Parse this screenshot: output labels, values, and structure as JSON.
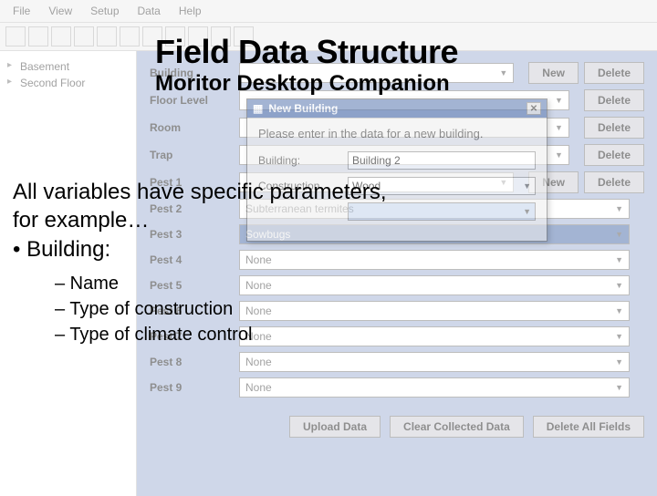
{
  "menubar": [
    "File",
    "View",
    "Setup",
    "Data",
    "Help"
  ],
  "tree": [
    "Basement",
    "Second Floor"
  ],
  "form": {
    "rows": [
      {
        "label": "Building",
        "value": "",
        "new": "New",
        "del": "Delete"
      },
      {
        "label": "Floor Level",
        "value": "",
        "new": "",
        "del": "Delete"
      },
      {
        "label": "Room",
        "value": "",
        "new": "",
        "del": "Delete"
      },
      {
        "label": "Trap",
        "value": "",
        "new": "",
        "del": "Delete"
      },
      {
        "label": "Pest 1",
        "value": "",
        "new": "New",
        "del": "Delete"
      },
      {
        "label": "Pest 2",
        "value": "Subterranean termites",
        "new": "",
        "del": ""
      },
      {
        "label": "Pest 3",
        "value": "Sowbugs",
        "new": "",
        "del": ""
      },
      {
        "label": "Pest 4",
        "value": "None",
        "new": "",
        "del": ""
      },
      {
        "label": "Pest 5",
        "value": "None",
        "new": "",
        "del": ""
      },
      {
        "label": "Pest 6",
        "value": "None",
        "new": "",
        "del": ""
      },
      {
        "label": "Pest 7",
        "value": "None",
        "new": "",
        "del": ""
      },
      {
        "label": "Pest 8",
        "value": "None",
        "new": "",
        "del": ""
      },
      {
        "label": "Pest 9",
        "value": "None",
        "new": "",
        "del": ""
      }
    ],
    "buttons": [
      "Upload Data",
      "Clear Collected Data",
      "Delete All Fields"
    ]
  },
  "dialog": {
    "title": "New Building",
    "close": "✕",
    "prompt": "Please enter in the data for a new building.",
    "fields": [
      {
        "label": "Building:",
        "value": "Building 2",
        "dropdown": false
      },
      {
        "label": "Construction",
        "value": "Wood",
        "dropdown": true
      },
      {
        "label": "",
        "value": "",
        "dropdown": true
      }
    ]
  },
  "overlay": {
    "title1": "Field Data Structure",
    "title2": "Moritor Desktop Companion",
    "body1a": "All variables have specific parameters,",
    "body1b": "for example…",
    "bullet": "• Building:",
    "sub1": "– Name",
    "sub2": "– Type of construction",
    "sub3": "– Type of climate control"
  }
}
